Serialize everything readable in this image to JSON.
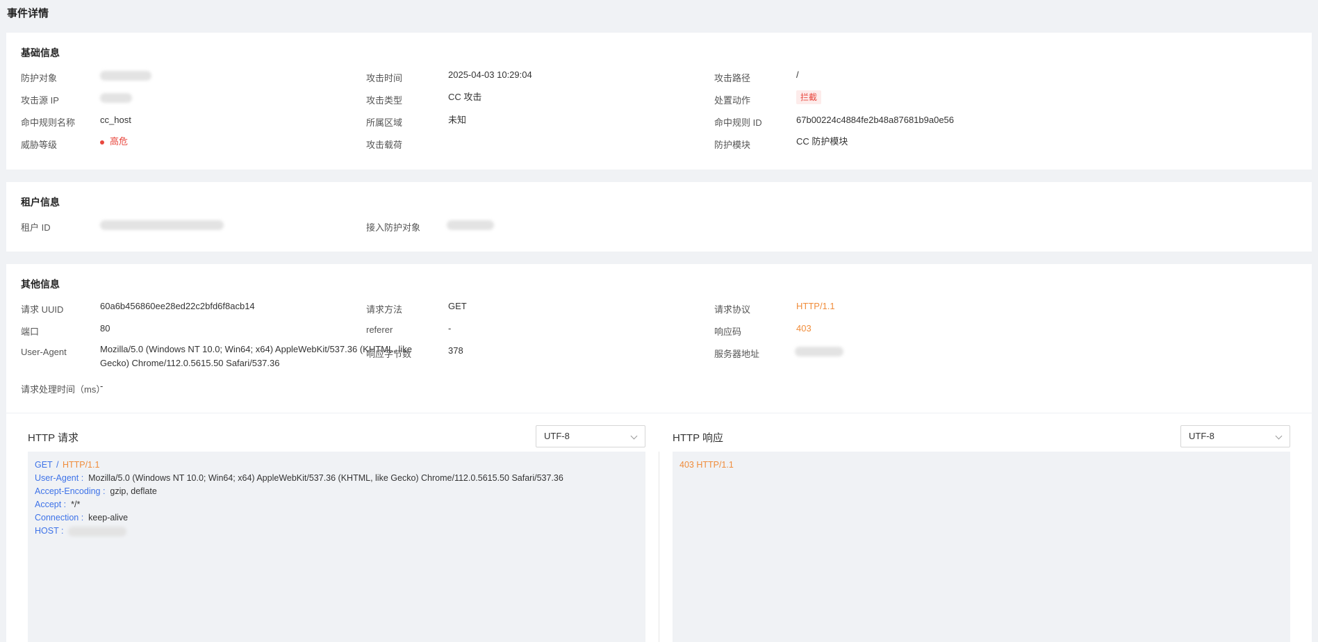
{
  "page_title": "事件详情",
  "basic": {
    "title": "基础信息",
    "fields": {
      "protect_target_label": "防护对象",
      "attack_time_label": "攻击时间",
      "attack_time": "2025-04-03 10:29:04",
      "attack_path_label": "攻击路径",
      "attack_path": "/",
      "source_ip_label": "攻击源 IP",
      "attack_type_label": "攻击类型",
      "attack_type": "CC 攻击",
      "action_label": "处置动作",
      "action": "拦截",
      "rule_name_label": "命中规则名称",
      "rule_name": "cc_host",
      "region_label": "所属区域",
      "region": "未知",
      "rule_id_label": "命中规则 ID",
      "rule_id": "67b00224c4884fe2b48a87681b9a0e56",
      "threat_level_label": "威胁等级",
      "threat_level": "高危",
      "payload_label": "攻击载荷",
      "module_label": "防护模块",
      "module": "CC 防护模块"
    }
  },
  "tenant": {
    "title": "租户信息",
    "tenant_id_label": "租户 ID",
    "access_target_label": "接入防护对象"
  },
  "other": {
    "title": "其他信息",
    "uuid_label": "请求 UUID",
    "uuid": "60a6b456860ee28ed22c2bfd6f8acb14",
    "method_label": "请求方法",
    "method": "GET",
    "protocol_label": "请求协议",
    "protocol": "HTTP/1.1",
    "port_label": "端口",
    "port": "80",
    "referer_label": "referer",
    "referer": "-",
    "status_label": "响应码",
    "status": "403",
    "ua_label": "User-Agent",
    "ua_line1": "Mozilla/5.0 (Windows NT 10.0; Win64; x64) AppleWebKit/537.36 (KHTML, like",
    "ua_line2": "Gecko) Chrome/112.0.5615.50 Safari/537.36",
    "resp_bytes_label": "响应字节数",
    "resp_bytes": "378",
    "server_addr_label": "服务器地址",
    "proc_time_label": "请求处理时间（ms）",
    "proc_time": "-"
  },
  "http_request": {
    "title": "HTTP 请求",
    "encoding": "UTF-8",
    "method": "GET",
    "slash": "/",
    "protocol": "HTTP/1.1",
    "headers": [
      {
        "key": "User-Agent :",
        "value": "Mozilla/5.0 (Windows NT 10.0; Win64; x64) AppleWebKit/537.36 (KHTML, like Gecko) Chrome/112.0.5615.50 Safari/537.36"
      },
      {
        "key": "Accept-Encoding :",
        "value": "gzip, deflate"
      },
      {
        "key": "Accept :",
        "value": "*/*"
      },
      {
        "key": "Connection :",
        "value": "keep-alive"
      }
    ],
    "host_key": "HOST :"
  },
  "http_response": {
    "title": "HTTP 响应",
    "encoding": "UTF-8",
    "status_line": "403 HTTP/1.1"
  },
  "colors": {
    "accent_orange": "#f08c3a",
    "danger_red": "#e8473e",
    "key_blue": "#3d72e8"
  }
}
